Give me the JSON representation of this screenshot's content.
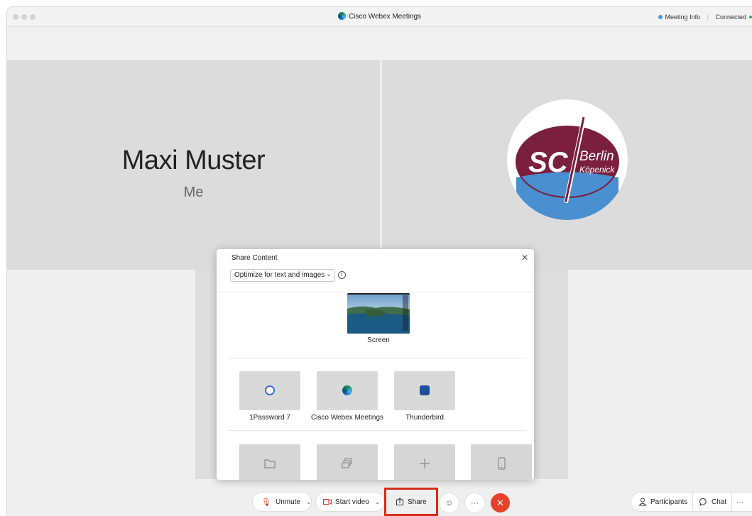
{
  "window": {
    "title": "Cisco Webex Meetings",
    "meeting_info": "Meeting Info",
    "status": "Connected"
  },
  "participants": {
    "self_name": "Maxi Muster",
    "self_tag": "Me",
    "remote_logo_text_main": "SC",
    "remote_logo_text_city": "Berlin",
    "remote_logo_text_district": "Köpenick"
  },
  "share_dialog": {
    "title": "Share Content",
    "close_icon": "close-icon",
    "optimize_value": "Optimize for text and images",
    "screen_label": "Screen",
    "apps": [
      {
        "label": "1Password 7",
        "icon": "1password-icon",
        "color": "#3b6fd6"
      },
      {
        "label": "Cisco Webex Meetings",
        "icon": "webex-icon",
        "color": "#1f8a4c"
      },
      {
        "label": "Thunderbird",
        "icon": "thunderbird-icon",
        "color": "#1d4f9c"
      }
    ],
    "tiles": [
      "folder-icon",
      "windows-icon",
      "plus-icon",
      "mobile-device-icon"
    ]
  },
  "toolbar": {
    "unmute": "Unmute",
    "start_video": "Start video",
    "share": "Share",
    "more": "···",
    "participants": "Participants",
    "chat": "Chat",
    "overflow": "···"
  },
  "colors": {
    "leave_red": "#e5412b",
    "highlight_red": "#d72b19",
    "logo_maroon": "#7a1f3d",
    "logo_blue": "#4a8fd0"
  }
}
